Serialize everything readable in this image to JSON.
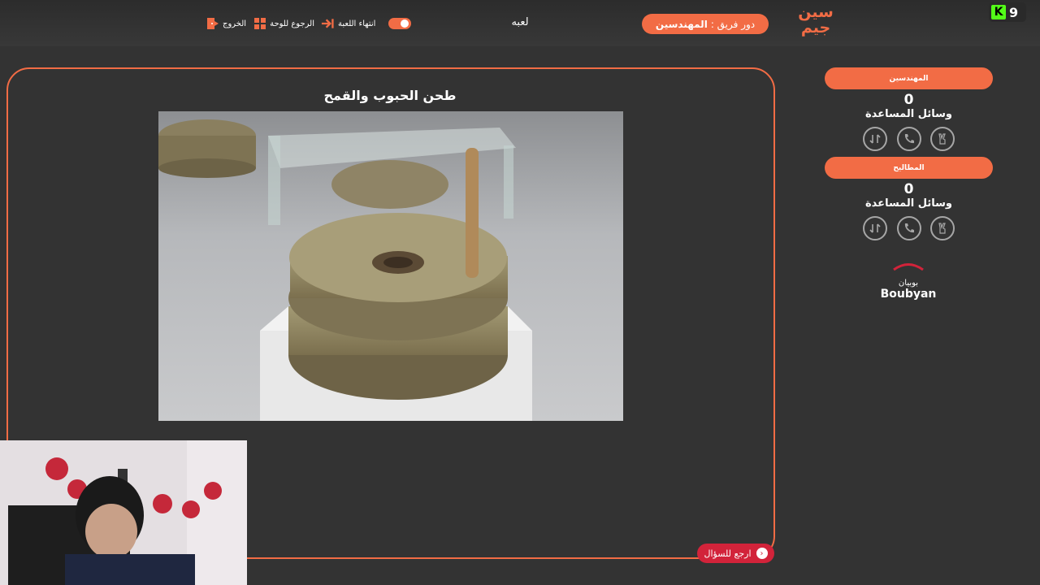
{
  "header": {
    "game_title": "لعبه",
    "team_turn_prefix": "دور فريق :",
    "team_turn_name": "المهندسين",
    "tools": {
      "end_game": "انتهاء اللعبة",
      "back_to_board": "الرجوع للوحة",
      "exit": "الخروج"
    },
    "logo_line1": "سين",
    "logo_line2": "جيم",
    "stream_viewers": "9"
  },
  "question": {
    "title": "طحن الحبوب والقمح",
    "back_label": "ارجع للسؤال"
  },
  "teams": [
    {
      "name": "المهندسين",
      "score": "0",
      "aids_label": "وسائل المساعدة"
    },
    {
      "name": "المطاليح",
      "score": "0",
      "aids_label": "وسائل المساعدة"
    }
  ],
  "sponsor": {
    "arabic": "بوبيان",
    "english": "Boubyan"
  },
  "colors": {
    "accent": "#f26c45",
    "background": "#333333",
    "back_button": "#d2233a",
    "kick_green": "#53fc18"
  }
}
